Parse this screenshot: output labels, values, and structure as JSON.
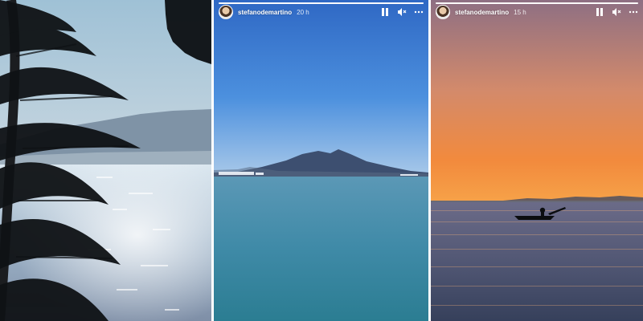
{
  "stories": [
    {
      "scene": "palm tree silhouette over sunlit sea with mountains",
      "header_visible": false
    },
    {
      "scene": "calm bay with Mount Vesuvius under clear blue sky",
      "header_visible": true,
      "username": "stefanodemartino",
      "time": "20 h",
      "progress": 1.0,
      "controls": [
        "pause-icon",
        "mute-icon",
        "more-icon"
      ]
    },
    {
      "scene": "orange sunset over sea with small rowing boat",
      "header_visible": true,
      "username": "stefanodemartino",
      "time": "15 h",
      "progress": 1.0,
      "controls": [
        "pause-icon",
        "mute-icon",
        "more-icon"
      ]
    }
  ],
  "colors": {
    "sky_blue": "#4c90de",
    "sea_blue": "#3f8aa7",
    "sunset_orange": "#f28a3d",
    "dusk_purple": "#8e6f83"
  }
}
